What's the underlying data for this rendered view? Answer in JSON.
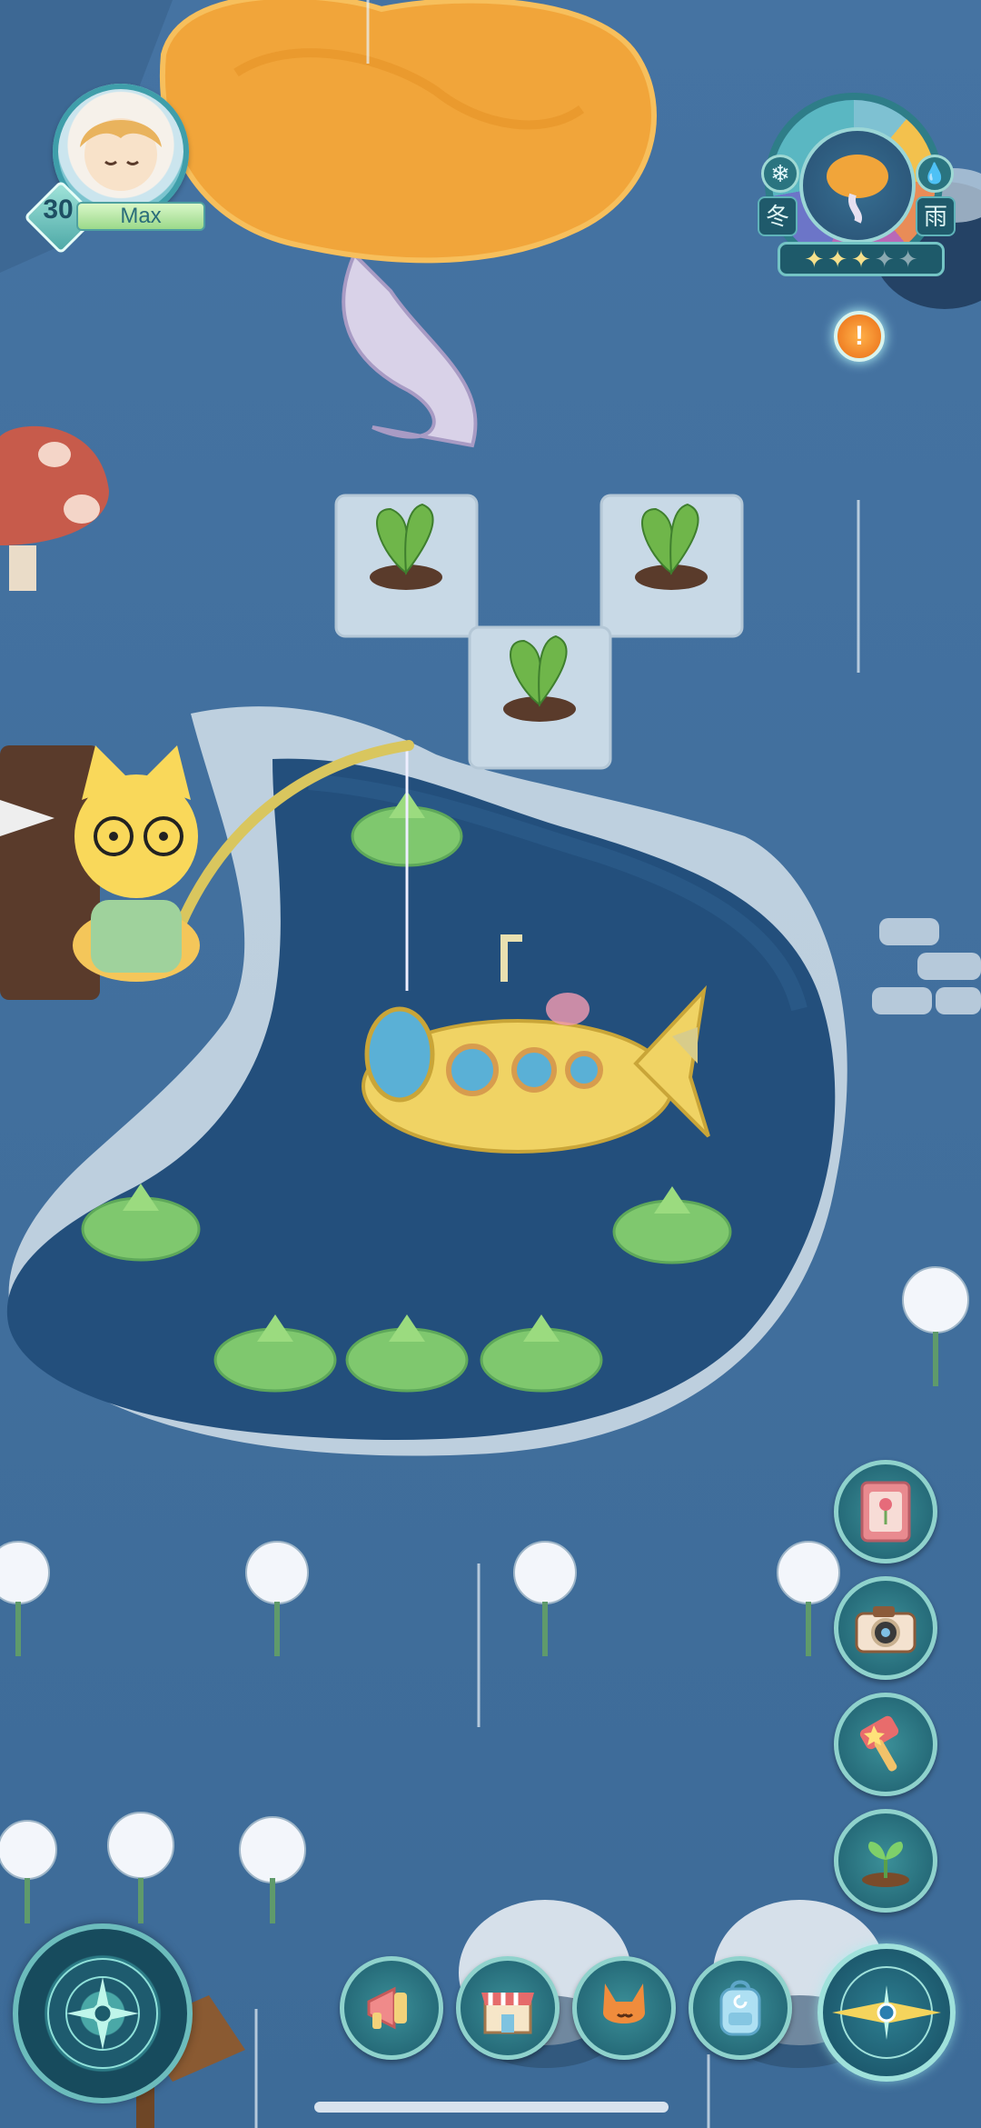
{
  "player": {
    "level": "30",
    "name": "Max",
    "avatar_icon": "girl-portrait-icon"
  },
  "season": {
    "season_label": "冬",
    "weather_label": "雨",
    "rating": 3,
    "rating_max": 5,
    "dial_icon": "tree-icon"
  },
  "alert": {
    "symbol": "!"
  },
  "side_menu": [
    {
      "name": "flower-book-button",
      "icon": "book-icon"
    },
    {
      "name": "camera-button",
      "icon": "camera-icon"
    },
    {
      "name": "hammer-button",
      "icon": "hammer-icon"
    },
    {
      "name": "sprout-button",
      "icon": "sprout-icon"
    }
  ],
  "bottom_bar": [
    {
      "name": "announcement-button",
      "icon": "megaphone-icon"
    },
    {
      "name": "shop-button",
      "icon": "shop-icon"
    },
    {
      "name": "pet-button",
      "icon": "fox-icon"
    },
    {
      "name": "backpack-button",
      "icon": "backpack-icon"
    }
  ],
  "colors": {
    "ground": "#3f6d9c",
    "pond": "#234f7c",
    "accent": "#8fd2cc",
    "tree_canopy": "#f1a53a"
  }
}
